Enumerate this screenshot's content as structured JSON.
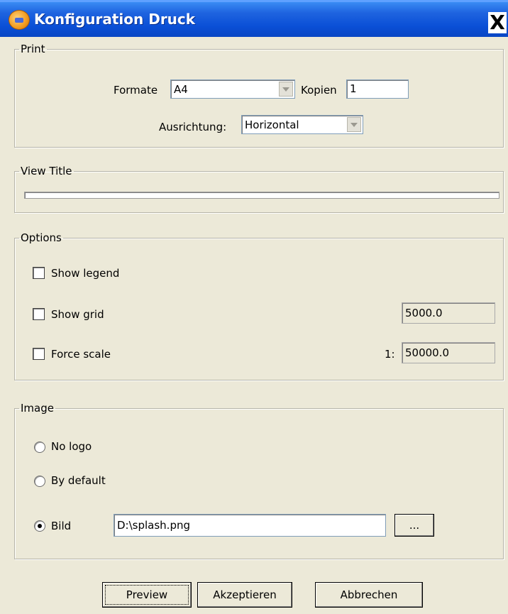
{
  "window": {
    "title": "Konfiguration Druck",
    "close_symbol": "X",
    "icon": "app-globe-icon"
  },
  "print": {
    "legend": "Print",
    "format_label": "Formate",
    "format_value": "A4",
    "copies_label": "Kopien",
    "copies_value": "1",
    "orientation_label": "Ausrichtung:",
    "orientation_value": "Horizontal"
  },
  "view_title": {
    "legend": "View Title",
    "value": ""
  },
  "options": {
    "legend": "Options",
    "show_legend_label": "Show legend",
    "show_legend_checked": false,
    "show_grid_label": "Show grid",
    "show_grid_checked": false,
    "grid_value": "5000.0",
    "force_scale_label": "Force scale",
    "force_scale_checked": false,
    "scale_prefix": "1:",
    "scale_value": "50000.0"
  },
  "image": {
    "legend": "Image",
    "no_logo_label": "No logo",
    "by_default_label": "By default",
    "bild_label": "Bild",
    "selected": "Bild",
    "path_value": "D:\\splash.png",
    "browse_label": "..."
  },
  "buttons": {
    "preview": "Preview",
    "accept": "Akzeptieren",
    "cancel": "Abbrechen"
  },
  "colors": {
    "titlebar": "#0a4fd6",
    "dialog_bg": "#ece9d8"
  }
}
